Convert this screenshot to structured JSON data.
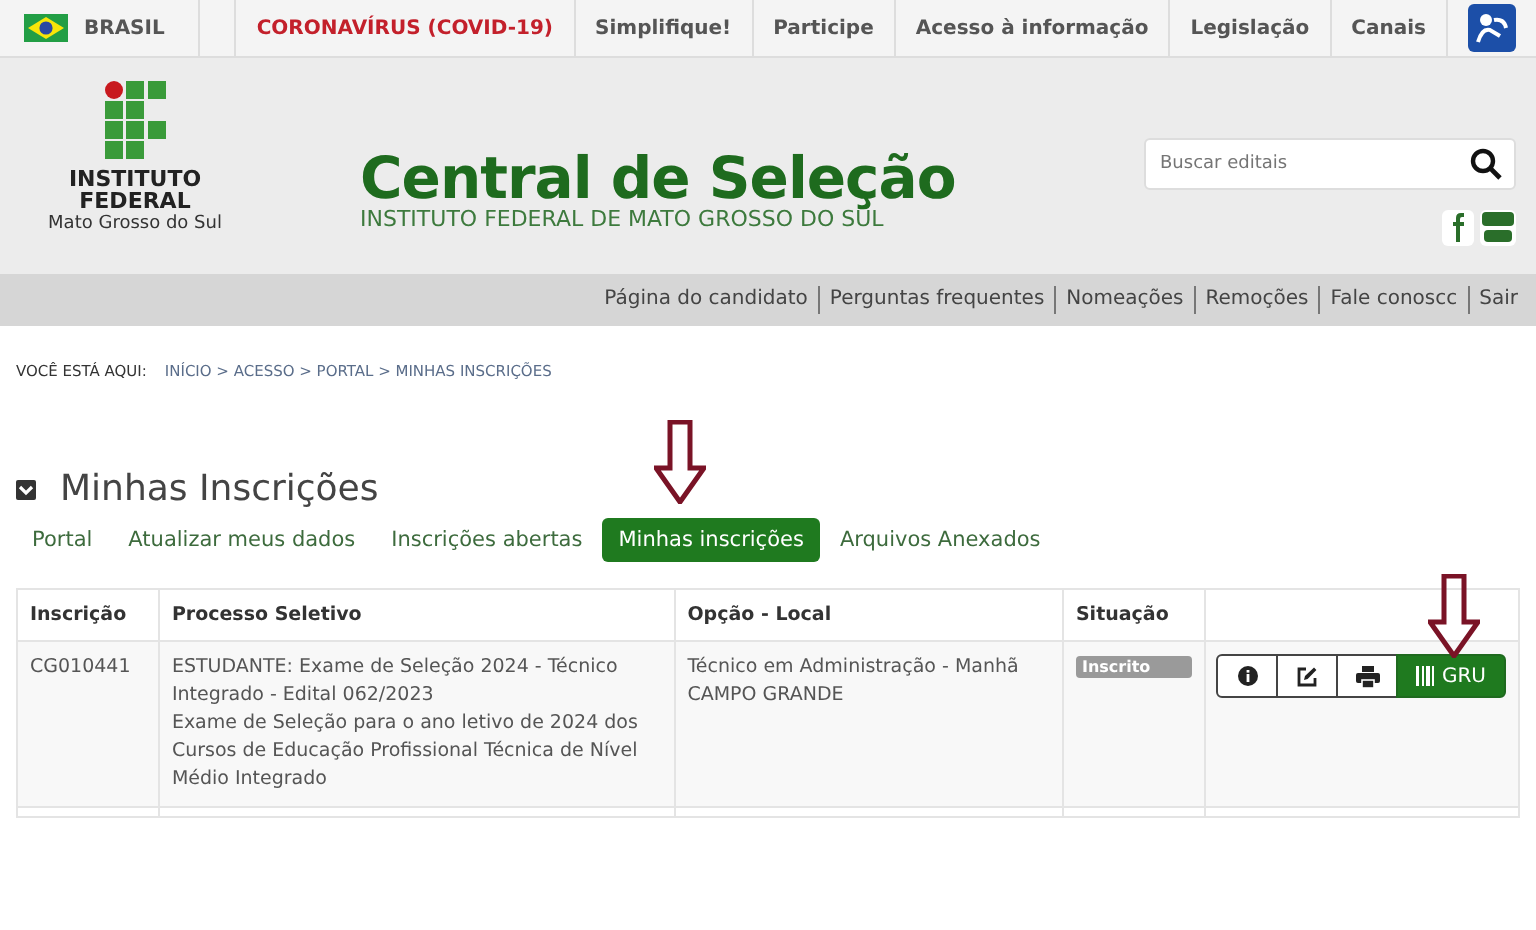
{
  "gov_bar": {
    "country": "BRASIL",
    "links": [
      {
        "label": "CORONAVÍRUS (COVID-19)",
        "kind": "alert"
      },
      {
        "label": "Simplifique!",
        "kind": "normal"
      },
      {
        "label": "Participe",
        "kind": "normal"
      },
      {
        "label": "Acesso à informação",
        "kind": "normal"
      },
      {
        "label": "Legislação",
        "kind": "normal"
      },
      {
        "label": "Canais",
        "kind": "normal"
      }
    ]
  },
  "header": {
    "logo_lines": [
      "INSTITUTO",
      "FEDERAL",
      "Mato Grosso do Sul"
    ],
    "title": "Central de Seleção",
    "subtitle": "INSTITUTO FEDERAL DE MATO GROSSO DO SUL",
    "search": {
      "placeholder": "Buscar editais"
    }
  },
  "user_nav": [
    "Página do candidato",
    "Perguntas frequentes",
    "Nomeações",
    "Remoções",
    "Fale conoscc",
    "Sair"
  ],
  "breadcrumb": {
    "label": "VOCÊ ESTÁ AQUI:",
    "path": "INÍCIO > ACESSO > PORTAL > MINHAS INSCRIÇÕES"
  },
  "section_title": "Minhas Inscrições",
  "tabs": [
    {
      "label": "Portal",
      "selected": false
    },
    {
      "label": "Atualizar meus dados",
      "selected": false
    },
    {
      "label": "Inscrições abertas",
      "selected": false
    },
    {
      "label": "Minhas inscrições",
      "selected": true
    },
    {
      "label": "Arquivos Anexados",
      "selected": false
    }
  ],
  "table": {
    "columns": [
      "Inscrição",
      "Processo Seletivo",
      "Opção - Local",
      "Situação"
    ],
    "rows": [
      {
        "inscricao": "CG010441",
        "processo": [
          "ESTUDANTE: Exame de Seleção 2024 - Técnico Integrado - Edital 062/2023",
          "Exame de Seleção para o ano letivo de 2024 dos Cursos de Educação Profissional Técnica de Nível Médio Integrado"
        ],
        "opcao": [
          "Técnico em Administração - Manhã",
          "CAMPO GRANDE"
        ],
        "situacao": "Inscrito",
        "gru_label": "GRU"
      }
    ]
  }
}
